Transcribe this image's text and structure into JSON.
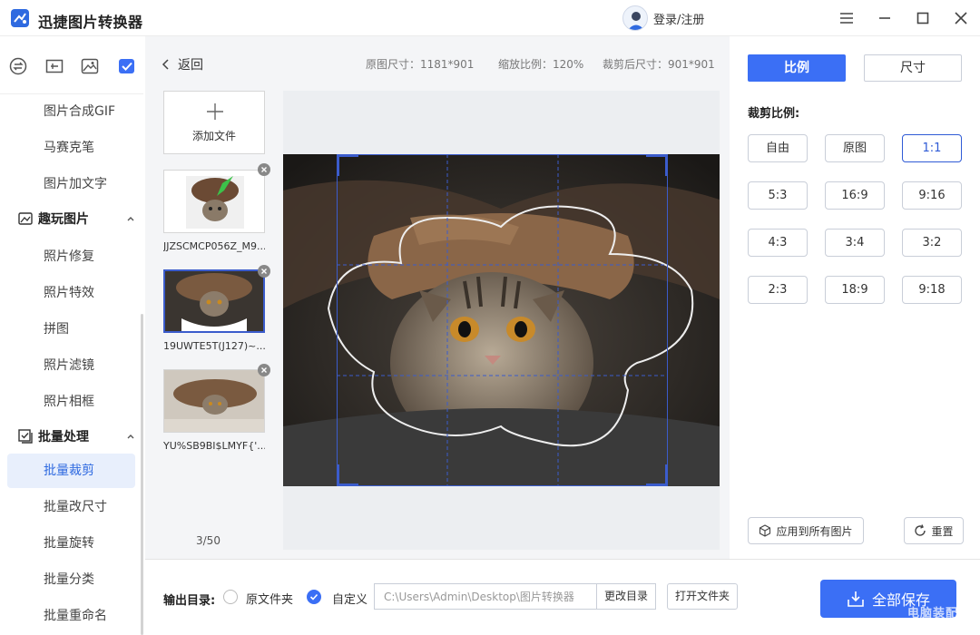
{
  "app": {
    "title": "迅捷图片转换器",
    "login": "登录/注册"
  },
  "sidebar": {
    "items_top": [
      {
        "label": "图片合成GIF"
      },
      {
        "label": "马赛克笔"
      },
      {
        "label": "图片加文字"
      }
    ],
    "group_fun": {
      "label": "趣玩图片"
    },
    "items_fun": [
      {
        "label": "照片修复"
      },
      {
        "label": "照片特效"
      },
      {
        "label": "拼图"
      },
      {
        "label": "照片滤镜"
      },
      {
        "label": "照片相框"
      }
    ],
    "group_batch": {
      "label": "批量处理"
    },
    "items_batch": [
      {
        "label": "批量裁剪",
        "active": true
      },
      {
        "label": "批量改尺寸"
      },
      {
        "label": "批量旋转"
      },
      {
        "label": "批量分类"
      },
      {
        "label": "批量重命名"
      }
    ]
  },
  "main": {
    "back": "返回",
    "original_size": "原图尺寸：1181*901",
    "zoom": "缩放比例：120%",
    "cropped_size": "裁剪后尺寸：901*901",
    "add_file": "添加文件",
    "files": [
      {
        "name": "JJZSCMCP056Z_M9..."
      },
      {
        "name": "19UWTE5T(J127)~..."
      },
      {
        "name": "YU%SB9BI$LMYF{'..."
      }
    ],
    "page_count": "3/50"
  },
  "right": {
    "tab_ratio": "比例",
    "tab_size": "尺寸",
    "ratio_label": "裁剪比例:",
    "ratios": [
      "自由",
      "原图",
      "1:1",
      "5:3",
      "16:9",
      "9:16",
      "4:3",
      "3:4",
      "3:2",
      "2:3",
      "18:9",
      "9:18"
    ],
    "selected_ratio": "1:1",
    "apply_all": "应用到所有图片",
    "reset": "重置"
  },
  "bottom": {
    "output_label": "输出目录:",
    "opt_original": "原文件夹",
    "opt_custom": "自定义",
    "path": "C:\\Users\\Admin\\Desktop\\图片转换器",
    "change_dir": "更改目录",
    "open_folder": "打开文件夹",
    "save_all": "全部保存",
    "watermark": "电脑装配网"
  },
  "colors": {
    "accent": "#3b6ff5",
    "active_bg": "#e8effc"
  }
}
